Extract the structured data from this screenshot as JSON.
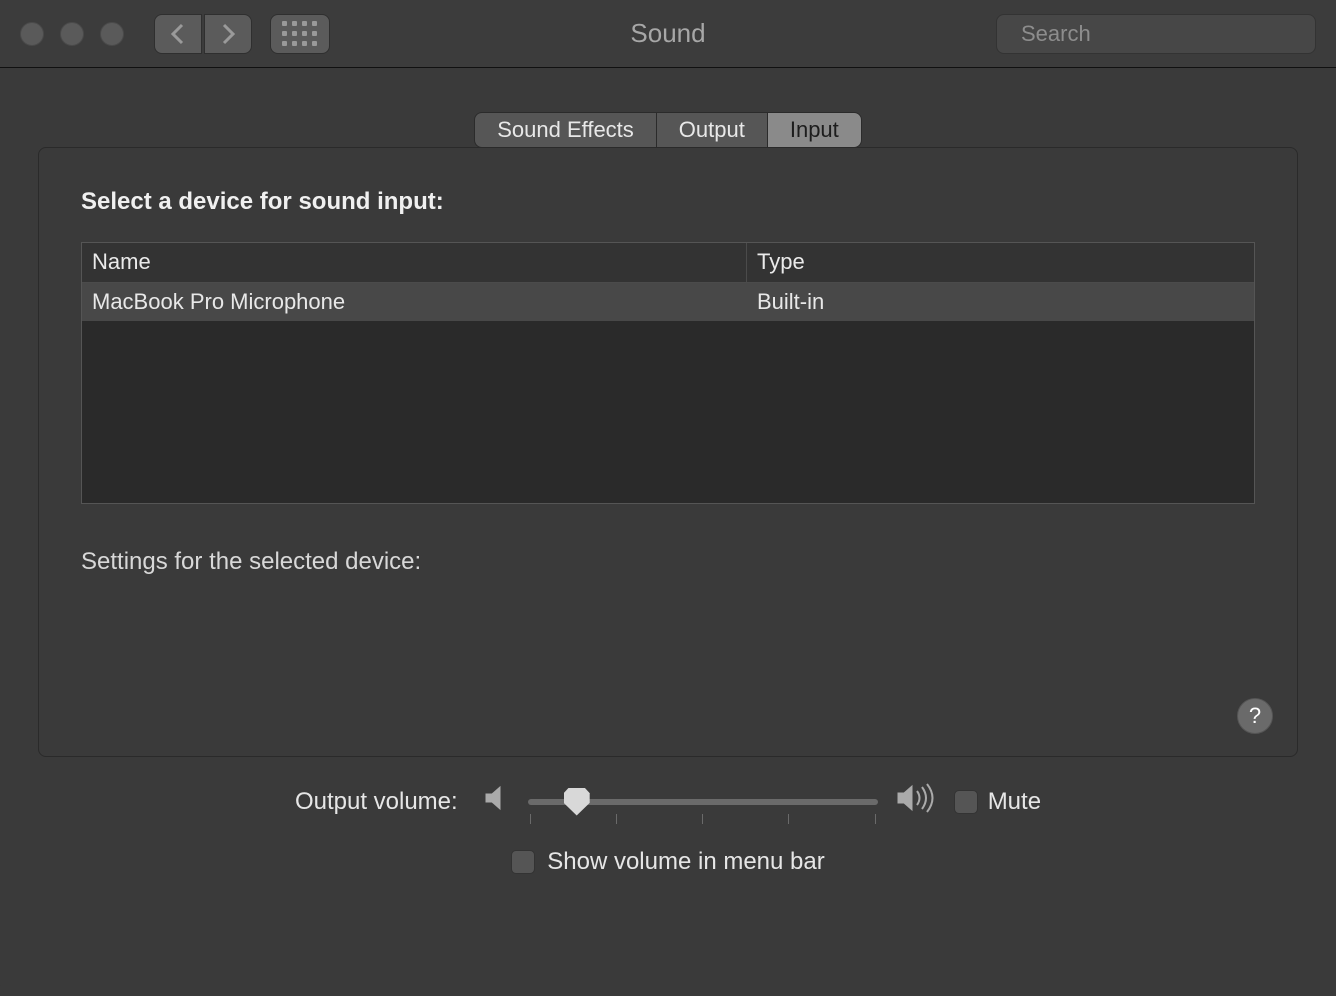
{
  "window": {
    "title": "Sound"
  },
  "search": {
    "placeholder": "Search"
  },
  "tabs": [
    {
      "label": "Sound Effects",
      "active": false
    },
    {
      "label": "Output",
      "active": false
    },
    {
      "label": "Input",
      "active": true
    }
  ],
  "input": {
    "select_label": "Select a device for sound input:",
    "columns": {
      "name": "Name",
      "type": "Type"
    },
    "devices": [
      {
        "name": "MacBook Pro Microphone",
        "type": "Built-in"
      }
    ],
    "settings_label": "Settings for the selected device:"
  },
  "help": {
    "label": "?"
  },
  "footer": {
    "output_volume_label": "Output volume:",
    "mute_label": "Mute",
    "show_in_menubar_label": "Show volume in menu bar",
    "volume_percent": 14
  }
}
